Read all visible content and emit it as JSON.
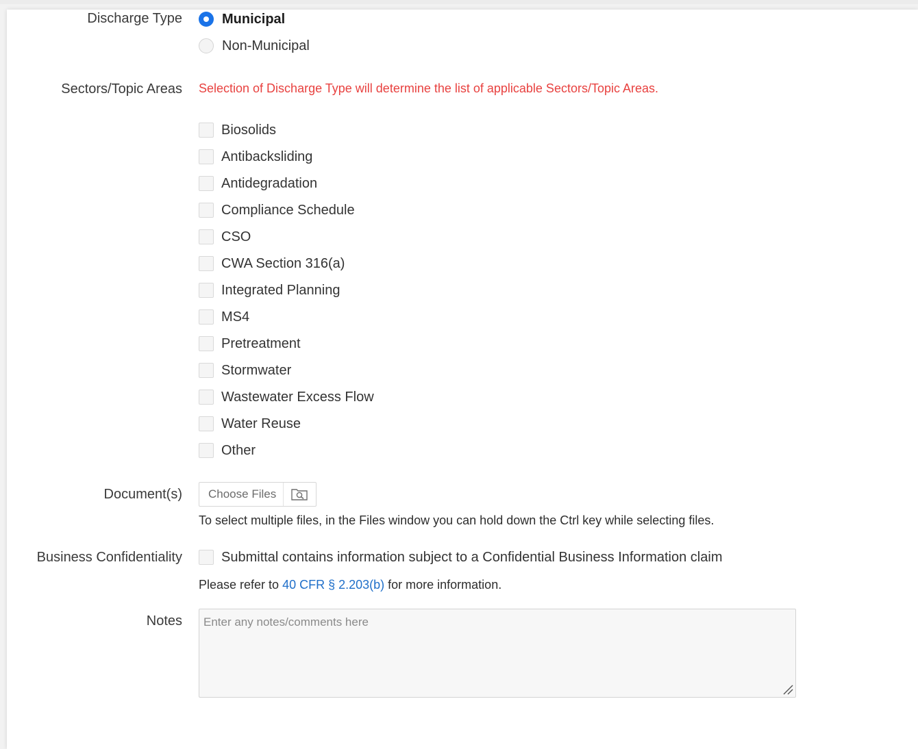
{
  "discharge_type": {
    "label": "Discharge Type",
    "options": [
      {
        "label": "Municipal",
        "selected": true
      },
      {
        "label": "Non-Municipal",
        "selected": false
      }
    ]
  },
  "sectors": {
    "label": "Sectors/Topic Areas",
    "hint": "Selection of Discharge Type will determine the list of applicable Sectors/Topic Areas.",
    "items": [
      {
        "label": "Biosolids",
        "checked": false
      },
      {
        "label": "Antibacksliding",
        "checked": false
      },
      {
        "label": "Antidegradation",
        "checked": false
      },
      {
        "label": "Compliance Schedule",
        "checked": false
      },
      {
        "label": "CSO",
        "checked": false
      },
      {
        "label": "CWA Section 316(a)",
        "checked": false
      },
      {
        "label": "Integrated Planning",
        "checked": false
      },
      {
        "label": "MS4",
        "checked": false
      },
      {
        "label": "Pretreatment",
        "checked": false
      },
      {
        "label": "Stormwater",
        "checked": false
      },
      {
        "label": "Wastewater Excess Flow",
        "checked": false
      },
      {
        "label": "Water Reuse",
        "checked": false
      },
      {
        "label": "Other",
        "checked": false
      }
    ]
  },
  "documents": {
    "label": "Document(s)",
    "button_label": "Choose Files",
    "folder_icon": "folder-search-icon",
    "help": "To select multiple files, in the Files window you can hold down the Ctrl key while selecting files."
  },
  "confidentiality": {
    "label": "Business Confidentiality",
    "checkbox_label": "Submittal contains information subject to a Confidential Business Information claim",
    "checked": false,
    "refer_prefix": "Please refer to ",
    "refer_link": "40 CFR § 2.203(b)",
    "refer_suffix": " for more information."
  },
  "notes": {
    "label": "Notes",
    "placeholder": "Enter any notes/comments here"
  },
  "colors": {
    "accent": "#1a73e8",
    "hint_red": "#e8413f",
    "link": "#1f6fc9"
  }
}
